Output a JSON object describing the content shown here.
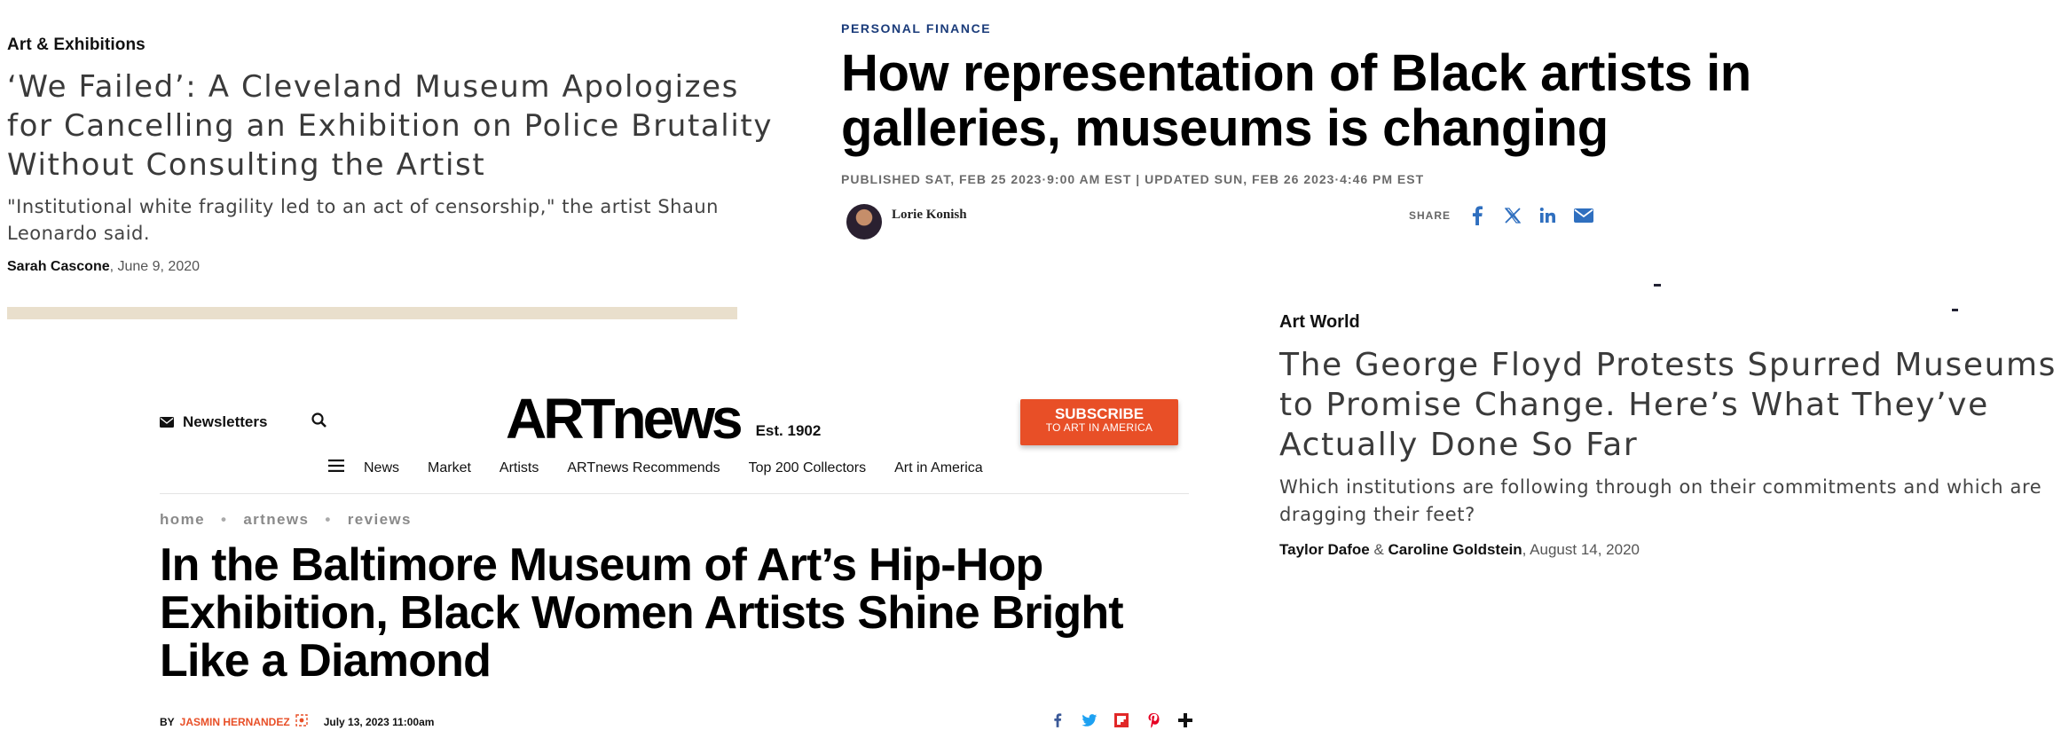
{
  "panel_a": {
    "category": "Art & Exhibitions",
    "headline": "‘We Failed’: A Cleveland Museum Apologizes for Cancelling an Exhibition on Police Brutality Without Consulting the Artist",
    "dek": "\"Institutional white fragility led to an act of censorship,\" the artist Shaun Leonardo said.",
    "author": "Sarah Cascone",
    "date": ", June 9, 2020"
  },
  "panel_b": {
    "section": "PERSONAL FINANCE",
    "headline": "How representation of Black artists in galleries, museums is changing",
    "dateline": "PUBLISHED SAT, FEB 25 2023·9:00 AM EST | UPDATED SUN, FEB 26 2023·4:46 PM EST",
    "author": "Lorie Konish",
    "share_label": "SHARE",
    "share_icons": [
      "facebook-icon",
      "x-icon",
      "linkedin-icon",
      "email-icon"
    ],
    "accent_color": "#1a3b7a",
    "icon_color": "#2f6fbf"
  },
  "panel_c": {
    "newsletters": "Newsletters",
    "logo": "ARTnews",
    "est": "Est. 1902",
    "subscribe_top": "SUBSCRIBE",
    "subscribe_bottom": "TO ART IN AMERICA",
    "nav": [
      "News",
      "Market",
      "Artists",
      "ARTnews Recommends",
      "Top 200 Collectors",
      "Art in America"
    ],
    "breadcrumbs": [
      "home",
      "artnews",
      "reviews"
    ],
    "headline": "In the Baltimore Museum of Art’s Hip-Hop Exhibition, Black Women Artists Shine Bright Like a Diamond",
    "byline_prefix": "BY",
    "author": "JASMIN HERNANDEZ",
    "date": "July 13, 2023 11:00am",
    "accent_color": "#e84f27"
  },
  "panel_d": {
    "category": "Art World",
    "headline": "The George Floyd Protests Spurred Museums to Promise Change. Here’s What They’ve Actually Done So Far",
    "dek": "Which institutions are following through on their commitments and which are dragging their feet?",
    "author1": "Taylor Dafoe",
    "amp": " & ",
    "author2": "Caroline Goldstein",
    "date": ", August 14, 2020"
  }
}
